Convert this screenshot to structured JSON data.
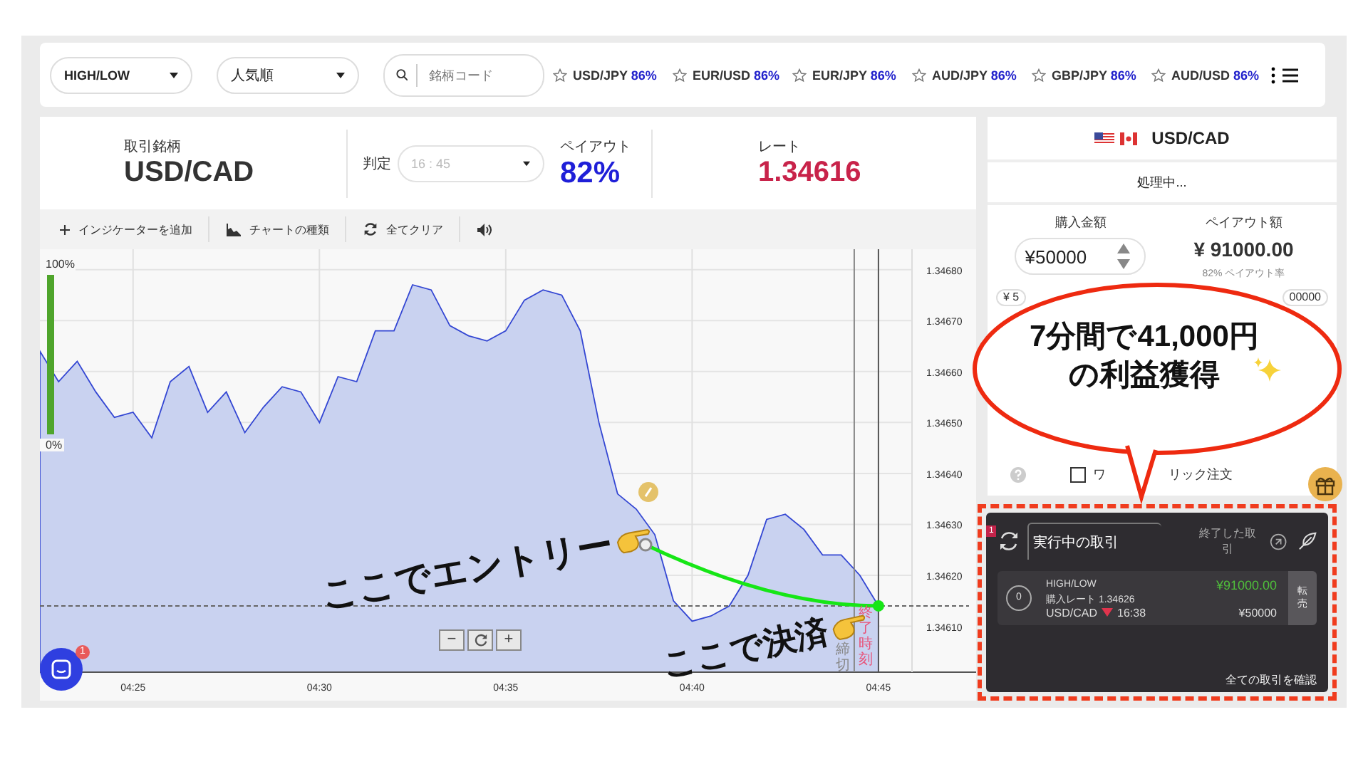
{
  "topbar": {
    "selects": [
      {
        "value": "HIGH/LOW"
      },
      {
        "value": "人気順"
      }
    ],
    "search": {
      "placeholder": "銘柄コード"
    },
    "favorites": [
      {
        "pair": "USD/JPY",
        "payout": "86%"
      },
      {
        "pair": "EUR/USD",
        "payout": "86%"
      },
      {
        "pair": "EUR/JPY",
        "payout": "86%"
      },
      {
        "pair": "AUD/JPY",
        "payout": "86%"
      },
      {
        "pair": "GBP/JPY",
        "payout": "86%"
      },
      {
        "pair": "AUD/USD",
        "payout": "86%"
      }
    ]
  },
  "header": {
    "symbol_label": "取引銘柄",
    "symbol": "USD/CAD",
    "judge_label": "判定",
    "expiry": "16 : 45",
    "expiry_disabled": true,
    "payout_label": "ペイアウト",
    "payout": "82%",
    "rate_label": "レート",
    "rate": "1.34616"
  },
  "toolbar": [
    {
      "kind": "add",
      "label": "インジケーターを追加"
    },
    {
      "kind": "chart-type",
      "label": "チャートの種類"
    },
    {
      "kind": "clear",
      "label": "全てクリア"
    },
    {
      "kind": "sound"
    }
  ],
  "chart": {
    "gauge": {
      "top_label": "100%",
      "bottom_label": "0%",
      "level": 1
    },
    "chart_data": {
      "type": "area",
      "ylim": [
        1.34601,
        1.34684
      ],
      "grid": true,
      "ref_lines": [
        {
          "axis": "y",
          "value": 1.34614
        }
      ],
      "categories": [
        null,
        null,
        null,
        null,
        null,
        "04:25",
        null,
        null,
        null,
        null,
        null,
        null,
        null,
        null,
        null,
        "04:30",
        null,
        null,
        null,
        null,
        null,
        null,
        null,
        null,
        null,
        "04:35",
        null,
        null,
        null,
        null,
        null,
        null,
        null,
        null,
        null,
        "04:40",
        null,
        null,
        null,
        null,
        null,
        null,
        null,
        null,
        null,
        "04:45"
      ],
      "yticks": [
        {
          "value": 1.3461,
          "label": "1.34610"
        },
        {
          "value": 1.3462,
          "label": "1.34620"
        },
        {
          "value": 1.3463,
          "label": "1.34630"
        },
        {
          "value": 1.3464,
          "label": "1.34640"
        },
        {
          "value": 1.3465,
          "label": "1.34650"
        },
        {
          "value": 1.3466,
          "label": "1.34660"
        },
        {
          "value": 1.3467,
          "label": "1.34670"
        },
        {
          "value": 1.3468,
          "label": "1.34680"
        }
      ],
      "series": [
        {
          "color": "#3346d3",
          "values": [
            1.34664,
            1.34658,
            1.34662,
            1.34656,
            1.34651,
            1.34652,
            1.34647,
            1.34658,
            1.34661,
            1.34652,
            1.34656,
            1.34648,
            1.34653,
            1.34657,
            1.34656,
            1.3465,
            1.34659,
            1.34658,
            1.34668,
            1.34668,
            1.34677,
            1.34676,
            1.34669,
            1.34667,
            1.34666,
            1.34668,
            1.34674,
            1.34676,
            1.34675,
            1.34668,
            1.3465,
            1.34636,
            1.34633,
            1.34628,
            1.34615,
            1.34611,
            1.34612,
            1.34614,
            1.3462,
            1.34631,
            1.34632,
            1.34629,
            1.34624,
            1.34624,
            1.3462,
            1.34614
          ]
        }
      ]
    },
    "deadline_label": "締切",
    "expiry_label": "終了時刻",
    "zoom_controls": [
      "−",
      "+"
    ],
    "chat_badge": "1",
    "notes": [
      {
        "kind": "entry",
        "text": "ここでエントリー"
      },
      {
        "kind": "exit",
        "text": "ここで決済"
      }
    ]
  },
  "order": {
    "pair": "USD/CAD",
    "status": "処理中...",
    "amount_label": "購入金額",
    "amount": "¥50000",
    "payout_label": "ペイアウト額",
    "payout": "¥ 91000.00",
    "payout_rate": "82% ペイアウト率",
    "quick_amounts": [
      "¥ 5",
      "00000"
    ],
    "one_click": {
      "label_parts": [
        "ワ",
        "リック注文"
      ],
      "checked": false
    }
  },
  "callout": {
    "lines": [
      "7分間で41,000円",
      "の利益獲得"
    ]
  },
  "trades": {
    "badge": "1",
    "tabs": [
      {
        "label": "実行中の取引",
        "selected": true
      },
      {
        "label": "終了した取引",
        "selected": false
      }
    ],
    "items": [
      {
        "count": "0",
        "type": "HIGH/LOW",
        "payout": "¥91000.00",
        "rate_label": "購入レート 1.34626",
        "pair": "USD/CAD",
        "down": true,
        "time": "16:38",
        "amount": "¥50000",
        "action": "転売"
      }
    ],
    "footer_link": "全ての取引を確認"
  }
}
